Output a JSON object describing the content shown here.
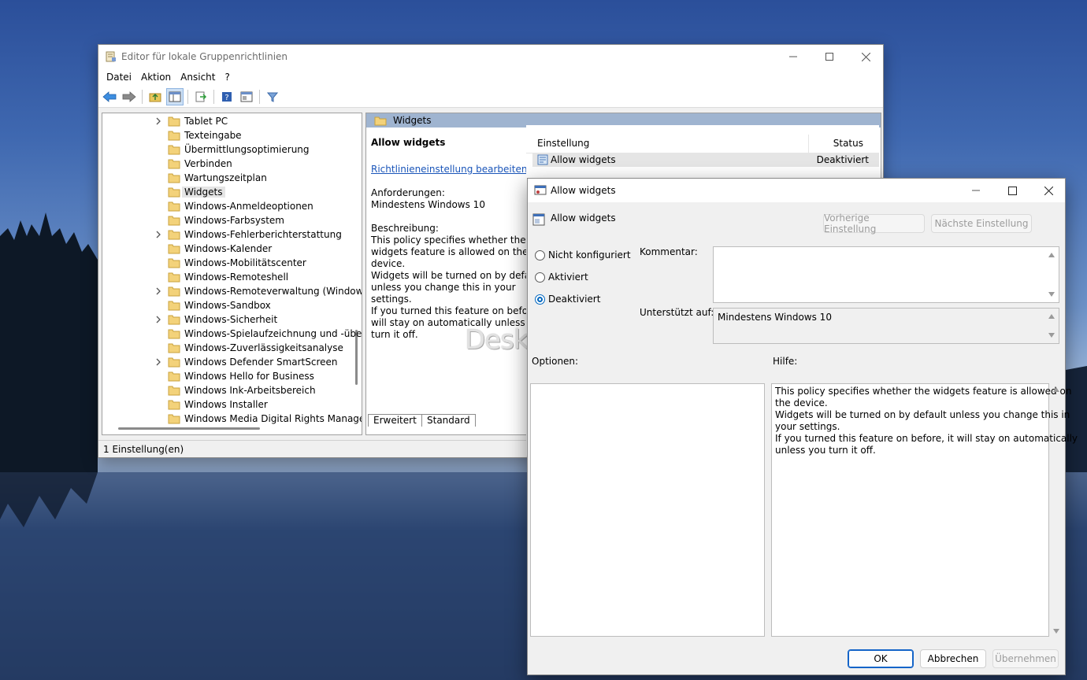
{
  "main_window": {
    "title": "Editor für lokale Gruppenrichtlinien",
    "menu": [
      "Datei",
      "Aktion",
      "Ansicht",
      "?"
    ],
    "tree_items": [
      {
        "label": "Tablet PC",
        "has_children": true,
        "selected": false
      },
      {
        "label": "Texteingabe",
        "has_children": false,
        "selected": false
      },
      {
        "label": "Übermittlungsoptimierung",
        "has_children": false,
        "selected": false
      },
      {
        "label": "Verbinden",
        "has_children": false,
        "selected": false
      },
      {
        "label": "Wartungszeitplan",
        "has_children": false,
        "selected": false
      },
      {
        "label": "Widgets",
        "has_children": false,
        "selected": true
      },
      {
        "label": "Windows-Anmeldeoptionen",
        "has_children": false,
        "selected": false
      },
      {
        "label": "Windows-Farbsystem",
        "has_children": false,
        "selected": false
      },
      {
        "label": "Windows-Fehlerberichterstattung",
        "has_children": true,
        "selected": false
      },
      {
        "label": "Windows-Kalender",
        "has_children": false,
        "selected": false
      },
      {
        "label": "Windows-Mobilitätscenter",
        "has_children": false,
        "selected": false
      },
      {
        "label": "Windows-Remoteshell",
        "has_children": false,
        "selected": false
      },
      {
        "label": "Windows-Remoteverwaltung (Windows",
        "has_children": true,
        "selected": false
      },
      {
        "label": "Windows-Sandbox",
        "has_children": false,
        "selected": false
      },
      {
        "label": "Windows-Sicherheit",
        "has_children": true,
        "selected": false
      },
      {
        "label": "Windows-Spielaufzeichnung und -übert",
        "has_children": false,
        "selected": false
      },
      {
        "label": "Windows-Zuverlässigkeitsanalyse",
        "has_children": false,
        "selected": false
      },
      {
        "label": "Windows Defender SmartScreen",
        "has_children": true,
        "selected": false
      },
      {
        "label": "Windows Hello for Business",
        "has_children": false,
        "selected": false
      },
      {
        "label": "Windows Ink-Arbeitsbereich",
        "has_children": false,
        "selected": false
      },
      {
        "label": "Windows Installer",
        "has_children": false,
        "selected": false
      },
      {
        "label": "Windows Media Digital Rights Managem",
        "has_children": false,
        "selected": false
      }
    ],
    "content_header": "Widgets",
    "description": {
      "title": "Allow widgets",
      "link": "Richtlinieneinstellung bearbeiten",
      "requirements_label": "Anforderungen:",
      "requirements_value": "Mindestens Windows 10",
      "description_label": "Beschreibung:",
      "lines": [
        "This policy specifies whether the",
        "widgets feature is allowed on the",
        "device.",
        "Widgets will be turned on by default",
        "unless you change this in your",
        "settings.",
        "If you turned this feature on before, it",
        "will stay on automatically unless you",
        "turn it off."
      ]
    },
    "list": {
      "col_setting": "Einstellung",
      "col_status": "Status",
      "rows": [
        {
          "setting": "Allow widgets",
          "status": "Deaktiviert"
        }
      ]
    },
    "tabs": [
      "Erweitert",
      "Standard"
    ],
    "status_text": "1 Einstellung(en)"
  },
  "dialog": {
    "title": "Allow widgets",
    "policy_name": "Allow widgets",
    "prev_button": "Vorherige Einstellung",
    "next_button": "Nächste Einstellung",
    "radio_not_configured": "Nicht konfiguriert",
    "radio_enabled": "Aktiviert",
    "radio_disabled": "Deaktiviert",
    "selected_option": "Deaktiviert",
    "comment_label": "Kommentar:",
    "comment_value": "",
    "supported_label": "Unterstützt auf:",
    "supported_value": "Mindestens Windows 10",
    "options_label": "Optionen:",
    "help_label": "Hilfe:",
    "help_lines": [
      "This policy specifies whether the widgets feature is allowed on",
      "the device.",
      "Widgets will be turned on by default unless you change this in",
      "your settings.",
      "If you turned this feature on before, it will stay on automatically",
      "unless you turn it off."
    ],
    "ok": "OK",
    "cancel": "Abbrechen",
    "apply": "Übernehmen"
  },
  "watermark": "Deskmodder.de",
  "colors": {
    "selection_header": "#9fb4d0",
    "link": "#1a55b9",
    "accent": "#0067c0"
  }
}
